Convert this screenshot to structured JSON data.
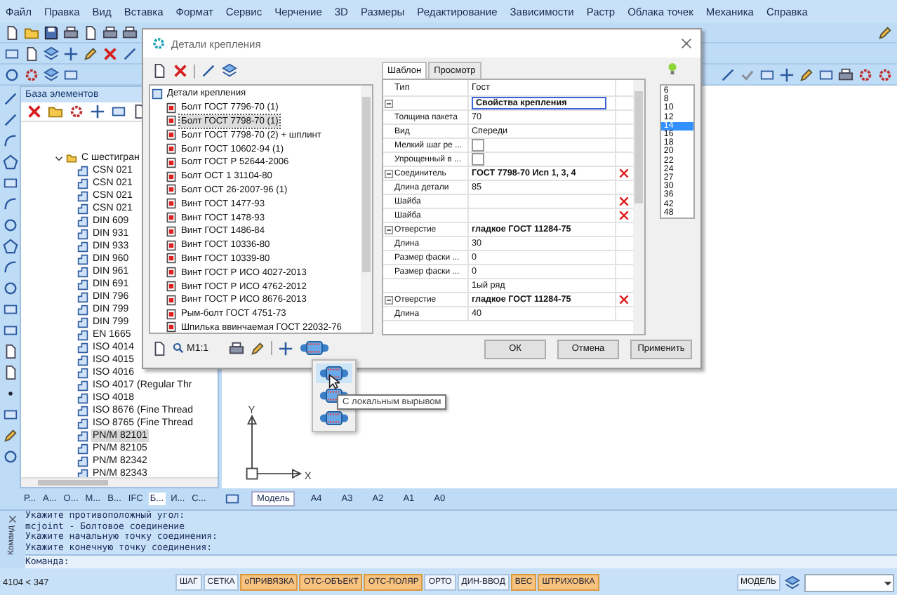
{
  "menu": [
    "Файл",
    "Правка",
    "Вид",
    "Вставка",
    "Формат",
    "Сервис",
    "Черчение",
    "3D",
    "Размеры",
    "Редактирование",
    "Зависимости",
    "Растр",
    "Облака точек",
    "Механика",
    "Справка"
  ],
  "left_panel": {
    "title": "База элементов",
    "tree": [
      {
        "label": "С шестигран",
        "expanded": true,
        "children": [
          {
            "label": "CSN 021",
            "selected": false
          },
          {
            "label": "CSN 021",
            "selected": false
          },
          {
            "label": "CSN 021",
            "selected": false
          },
          {
            "label": "CSN 021",
            "selected": false
          },
          {
            "label": "DIN 609",
            "selected": false
          },
          {
            "label": "DIN 931",
            "selected": false
          },
          {
            "label": "DIN 933",
            "selected": false
          },
          {
            "label": "DIN 960",
            "selected": false
          },
          {
            "label": "DIN 961",
            "selected": false
          },
          {
            "label": "DIN 691",
            "selected": false
          },
          {
            "label": "DIN 796",
            "selected": false
          },
          {
            "label": "DIN 799",
            "selected": false
          },
          {
            "label": "DIN 799",
            "selected": false
          },
          {
            "label": "EN 1665",
            "selected": false
          },
          {
            "label": "ISO 4014",
            "selected": false
          },
          {
            "label": "ISO 4015",
            "selected": false
          },
          {
            "label": "ISO 4016",
            "selected": false
          },
          {
            "label": "ISO 4017 (Regular Thr",
            "selected": false
          },
          {
            "label": "ISO 4018",
            "selected": false
          },
          {
            "label": "ISO 8676 (Fine Thread",
            "selected": false
          },
          {
            "label": "ISO 8765 (Fine Thread",
            "selected": false
          },
          {
            "label": "PN/M 82101",
            "selected": true
          },
          {
            "label": "PN/M 82105",
            "selected": false
          },
          {
            "label": "PN/M 82342",
            "selected": false
          },
          {
            "label": "PN/M 82343",
            "selected": false
          }
        ]
      }
    ]
  },
  "left_tabs": [
    {
      "label": "Р...",
      "selected": false
    },
    {
      "label": "А...",
      "selected": false
    },
    {
      "label": "О...",
      "selected": false
    },
    {
      "label": "М...",
      "selected": false
    },
    {
      "label": "В...",
      "selected": false
    },
    {
      "label": "IFC",
      "selected": false
    },
    {
      "label": "Б...",
      "selected": true
    },
    {
      "label": "И...",
      "selected": false
    },
    {
      "label": "С...",
      "selected": false
    }
  ],
  "dialog": {
    "title": "Детали крепления",
    "tree": {
      "label": "Детали крепления",
      "children": [
        {
          "label": "Болт ГОСТ 7796-70 (1)",
          "selected": false
        },
        {
          "label": "Болт ГОСТ 7798-70 (1)",
          "selected": true
        },
        {
          "label": "Болт ГОСТ 7798-70 (2) + шплинт",
          "selected": false
        },
        {
          "label": "Болт ГОСТ 10602-94 (1)",
          "selected": false
        },
        {
          "label": "Болт ГОСТ Р 52644-2006",
          "selected": false
        },
        {
          "label": "Болт ОСТ 1 31104-80",
          "selected": false
        },
        {
          "label": "Болт ОСТ 26-2007-96 (1)",
          "selected": false
        },
        {
          "label": "Винт ГОСТ 1477-93",
          "selected": false
        },
        {
          "label": "Винт ГОСТ 1478-93",
          "selected": false
        },
        {
          "label": "Винт ГОСТ 1486-84",
          "selected": false
        },
        {
          "label": "Винт ГОСТ 10336-80",
          "selected": false
        },
        {
          "label": "Винт ГОСТ 10339-80",
          "selected": false
        },
        {
          "label": "Винт ГОСТ Р ИСО 4027-2013",
          "selected": false
        },
        {
          "label": "Винт ГОСТ Р ИСО 4762-2012",
          "selected": false
        },
        {
          "label": "Винт ГОСТ Р ИСО 8676-2013",
          "selected": false
        },
        {
          "label": "Рым-болт ГОСТ 4751-73",
          "selected": false
        },
        {
          "label": "Шпилька ввинчаемая ГОСТ 22032-76",
          "selected": false
        }
      ]
    },
    "scale": "М1:1",
    "tabs": [
      {
        "label": "Шаблон",
        "selected": true
      },
      {
        "label": "Просмотр",
        "selected": false
      }
    ],
    "grid": {
      "columns": [
        "Тип",
        "Гост"
      ],
      "rows": [
        {
          "kind": "group",
          "value": "Свойства крепления",
          "editing": true,
          "removable": false
        },
        {
          "kind": "text",
          "label": "Толщина пакета",
          "value": "70",
          "editing": false,
          "removable": false
        },
        {
          "kind": "text",
          "label": "Вид",
          "value": "Спереди",
          "editing": false,
          "removable": false
        },
        {
          "kind": "check",
          "label": "Мелкий шаг ре ...",
          "checked": false,
          "editing": false,
          "removable": false
        },
        {
          "kind": "check",
          "label": "Упрощенный в ...",
          "checked": false,
          "editing": false,
          "removable": false
        },
        {
          "kind": "group",
          "label": "Соединитель",
          "value": "ГОСТ 7798-70 Исп 1, 3, 4",
          "editing": false,
          "removable": true
        },
        {
          "kind": "text",
          "label": "Длина детали",
          "value": "85",
          "editing": false,
          "removable": false
        },
        {
          "kind": "text",
          "label": "Шайба",
          "editing": false,
          "removable": true
        },
        {
          "kind": "text",
          "label": "Шайба",
          "editing": false,
          "removable": true
        },
        {
          "kind": "group",
          "label": "Отверстие",
          "value": "гладкое ГОСТ 11284-75",
          "editing": false,
          "removable": false
        },
        {
          "kind": "text",
          "label": "Длина",
          "value": "30",
          "editing": false,
          "removable": false
        },
        {
          "kind": "text",
          "label": "Размер фаски ...",
          "value": "0",
          "editing": false,
          "removable": false
        },
        {
          "kind": "text",
          "label": "Размер фаски ...",
          "value": "0",
          "editing": false,
          "removable": false
        },
        {
          "kind": "text",
          "value": "1ый ряд",
          "editing": false,
          "removable": false
        },
        {
          "kind": "group",
          "label": "Отверстие",
          "value": "гладкое ГОСТ 11284-75",
          "editing": false,
          "removable": true
        },
        {
          "kind": "text",
          "label": "Длина",
          "value": "40",
          "editing": false,
          "removable": false
        }
      ]
    },
    "sizes": [
      {
        "label": "6",
        "selected": false
      },
      {
        "label": "8",
        "selected": false
      },
      {
        "label": "10",
        "selected": false
      },
      {
        "label": "12",
        "selected": false
      },
      {
        "label": "14",
        "selected": true
      },
      {
        "label": "16",
        "selected": false
      },
      {
        "label": "18",
        "selected": false
      },
      {
        "label": "20",
        "selected": false
      },
      {
        "label": "22",
        "selected": false
      },
      {
        "label": "24",
        "selected": false
      },
      {
        "label": "27",
        "selected": false
      },
      {
        "label": "30",
        "selected": false
      },
      {
        "label": "36",
        "selected": false
      },
      {
        "label": "42",
        "selected": false
      },
      {
        "label": "48",
        "selected": false
      }
    ],
    "buttons": [
      "ОК",
      "Отмена",
      "Применить"
    ]
  },
  "popup": {
    "tooltip": "С локальным вырывом"
  },
  "ucs": {
    "y_label": "Y",
    "x_label": "X"
  },
  "layout_tabs": [
    {
      "label": "Модель",
      "selected": true
    },
    {
      "label": "А4",
      "selected": false
    },
    {
      "label": "А3",
      "selected": false
    },
    {
      "label": "А2",
      "selected": false
    },
    {
      "label": "А1",
      "selected": false
    },
    {
      "label": "А0",
      "selected": false
    }
  ],
  "command": {
    "title": "Команд",
    "lines": [
      "Укажите противоположный угол:",
      "mcjoint - Болтовое соединение",
      "Укажите начальную точку соединения:",
      "Укажите конечную точку соединения:"
    ],
    "prompt": "Команда:"
  },
  "status": {
    "coordinates": "4104 < 347",
    "toggles": [
      {
        "label": "ШАГ",
        "on": false
      },
      {
        "label": "СЕТКА",
        "on": false
      },
      {
        "label": "оПРИВЯЗКА",
        "on": true
      },
      {
        "label": "ОТС-ОБЪЕКТ",
        "on": true
      },
      {
        "label": "ОТС-ПОЛЯР",
        "on": true
      },
      {
        "label": "ОРТО",
        "on": false
      },
      {
        "label": "ДИН-ВВОД",
        "on": false
      },
      {
        "label": "ВЕС",
        "on": true
      },
      {
        "label": "ШТРИХОВКА",
        "on": true
      }
    ],
    "mode": "МОДЕЛЬ"
  }
}
